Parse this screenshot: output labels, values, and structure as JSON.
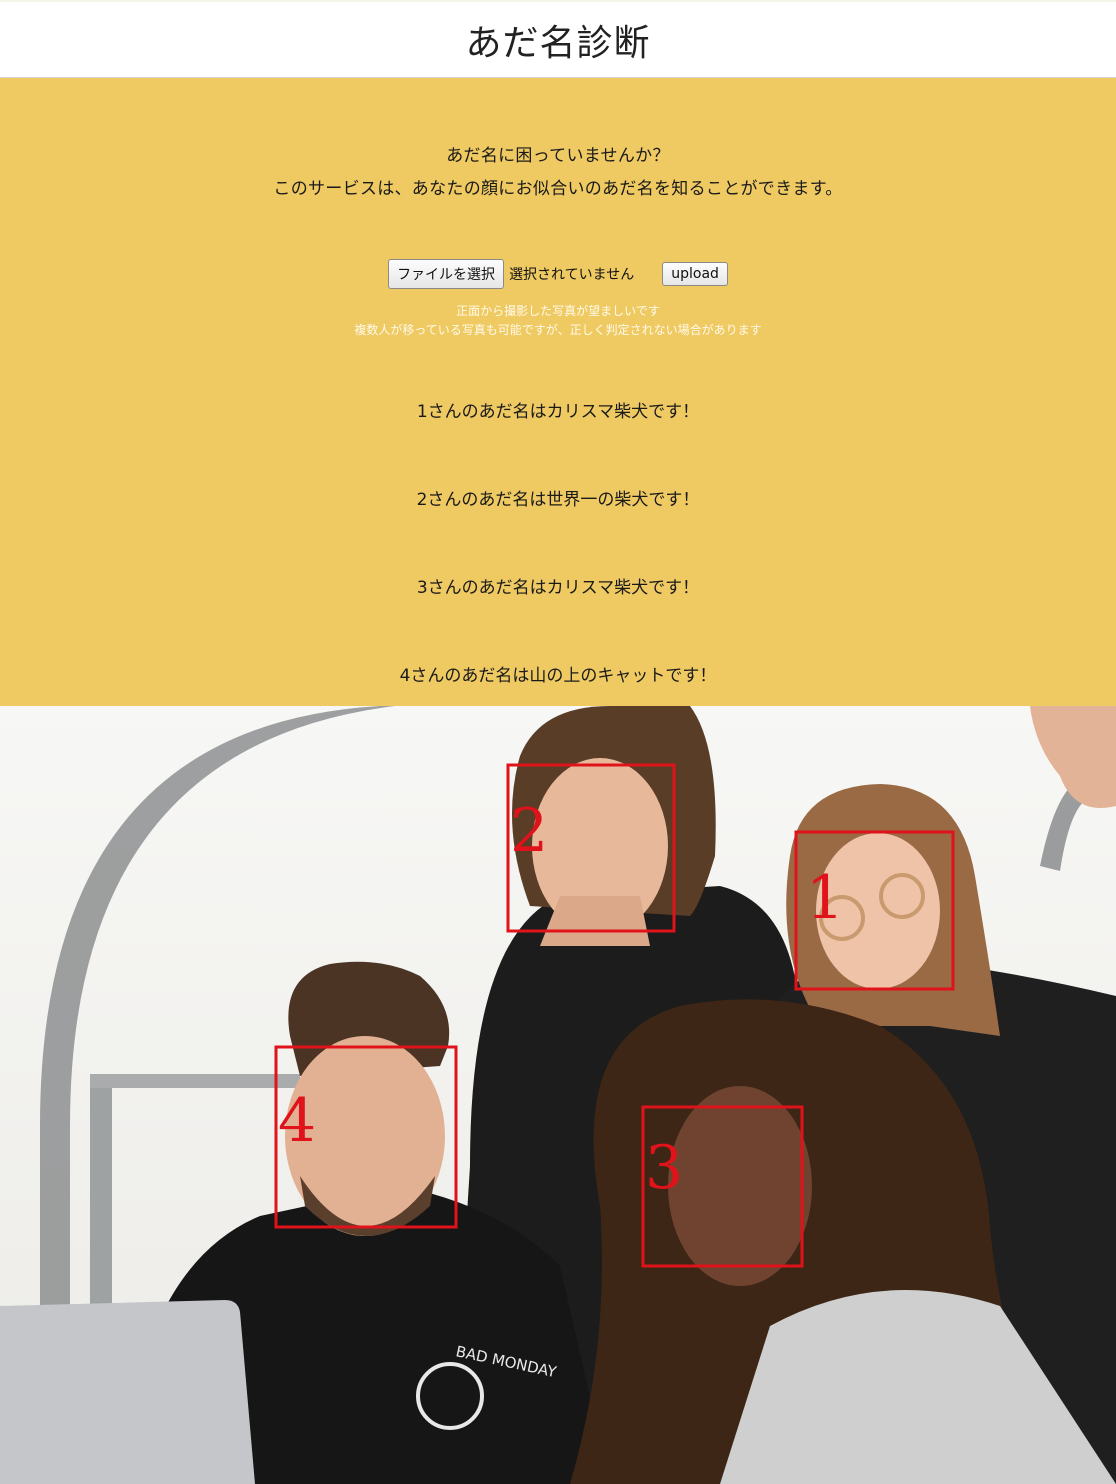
{
  "header": {
    "title": "あだ名診断"
  },
  "intro": {
    "line1": "あだ名に困っていませんか？",
    "line2": "このサービスは、あなたの顔にお似合いのあだ名を知ることができます。"
  },
  "upload": {
    "file_button_label": "ファイルを選択",
    "no_file_text": "選択されていません",
    "submit_label": "upload"
  },
  "hints": {
    "line1": "正面から撮影した写真が望ましいです",
    "line2": "複数人が移っている写真も可能ですが、正しく判定されない場合があります"
  },
  "results": [
    {
      "text": "1さんのあだ名はカリスマ柴犬です！"
    },
    {
      "text": "2さんのあだ名は世界一の柴犬です！"
    },
    {
      "text": "3さんのあだ名はカリスマ柴犬です！"
    },
    {
      "text": "4さんのあだ名は山の上のキャットです！"
    }
  ],
  "photo": {
    "shirt_print": "BAD MONDAY",
    "faces": [
      {
        "label": "1"
      },
      {
        "label": "2"
      },
      {
        "label": "3"
      },
      {
        "label": "4"
      }
    ]
  },
  "colors": {
    "main_background": "#efc962",
    "face_box": "#e0121a",
    "header_background": "#ffffff"
  }
}
